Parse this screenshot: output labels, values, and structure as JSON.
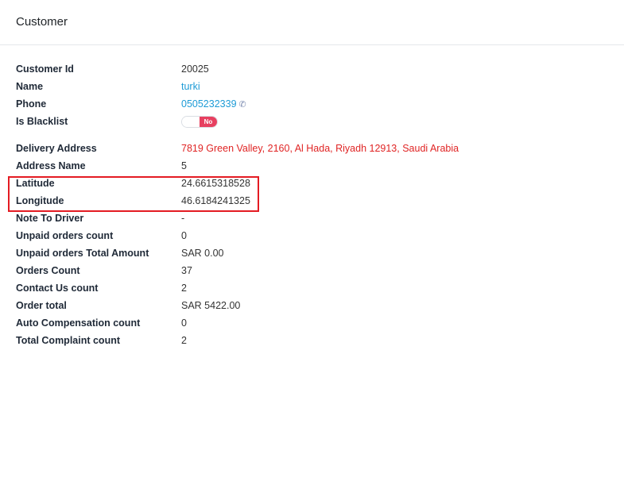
{
  "header": {
    "title": "Customer"
  },
  "customer": {
    "customer_id": {
      "label": "Customer Id",
      "value": "20025"
    },
    "name": {
      "label": "Name",
      "value": "turki"
    },
    "phone": {
      "label": "Phone",
      "value": "0505232339",
      "icon": "phone-icon"
    },
    "is_blacklist": {
      "label": "Is Blacklist",
      "value": "No"
    },
    "delivery_address": {
      "label": "Delivery Address",
      "value": "7819 Green Valley, 2160, Al Hada, Riyadh 12913, Saudi Arabia"
    },
    "address_name": {
      "label": "Address Name",
      "value": "5"
    },
    "latitude": {
      "label": "Latitude",
      "value": "24.6615318528"
    },
    "longitude": {
      "label": "Longitude",
      "value": "46.6184241325"
    },
    "note_to_driver": {
      "label": "Note To Driver",
      "value": "-"
    },
    "unpaid_orders_count": {
      "label": "Unpaid orders count",
      "value": "0"
    },
    "unpaid_orders_total": {
      "label": "Unpaid orders Total Amount",
      "value": "SAR 0.00"
    },
    "orders_count": {
      "label": "Orders Count",
      "value": "37"
    },
    "contact_us_count": {
      "label": "Contact Us count",
      "value": "2"
    },
    "order_total": {
      "label": "Order total",
      "value": "SAR 5422.00"
    },
    "auto_compensation_count": {
      "label": "Auto Compensation count",
      "value": "0"
    },
    "total_complaint_count": {
      "label": "Total Complaint count",
      "value": "2"
    }
  },
  "colors": {
    "link": "#1e9bd6",
    "address": "#e02424",
    "toggle_off": "#e74060",
    "highlight": "#e41b23"
  }
}
